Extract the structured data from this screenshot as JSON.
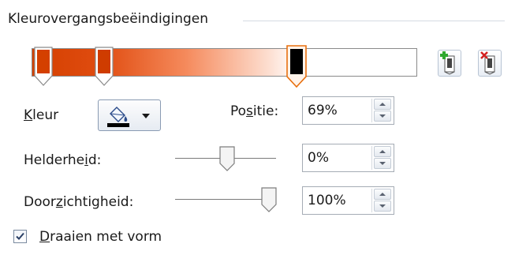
{
  "section": {
    "title": "Kleurovergangsbeëindigingen"
  },
  "gradient": {
    "stops": [
      {
        "position_pct": 0,
        "color": "#d44000",
        "selected": false
      },
      {
        "position_pct": 18,
        "color": "#e04c10",
        "selected": false
      },
      {
        "position_pct": 69,
        "color": "#000000",
        "selected": true
      }
    ]
  },
  "buttons": {
    "add_stop": "add-gradient-stop-icon",
    "remove_stop": "remove-gradient-stop-icon"
  },
  "color": {
    "label_key": "K",
    "label_rest": "leur",
    "swatch_color": "#000000"
  },
  "position": {
    "label_pre": "Po",
    "label_key": "s",
    "label_post": "itie:",
    "value": "69%"
  },
  "brightness": {
    "label_pre": "Helderhe",
    "label_key": "i",
    "label_post": "d:",
    "value": "0%",
    "level_pct": 0
  },
  "transparency": {
    "label_pre": "Door",
    "label_key": "z",
    "label_post": "ichtigheid:",
    "value": "100%",
    "level_pct": 100
  },
  "rotate": {
    "label_key": "D",
    "label_rest": "raaien met vorm",
    "checked": true
  }
}
